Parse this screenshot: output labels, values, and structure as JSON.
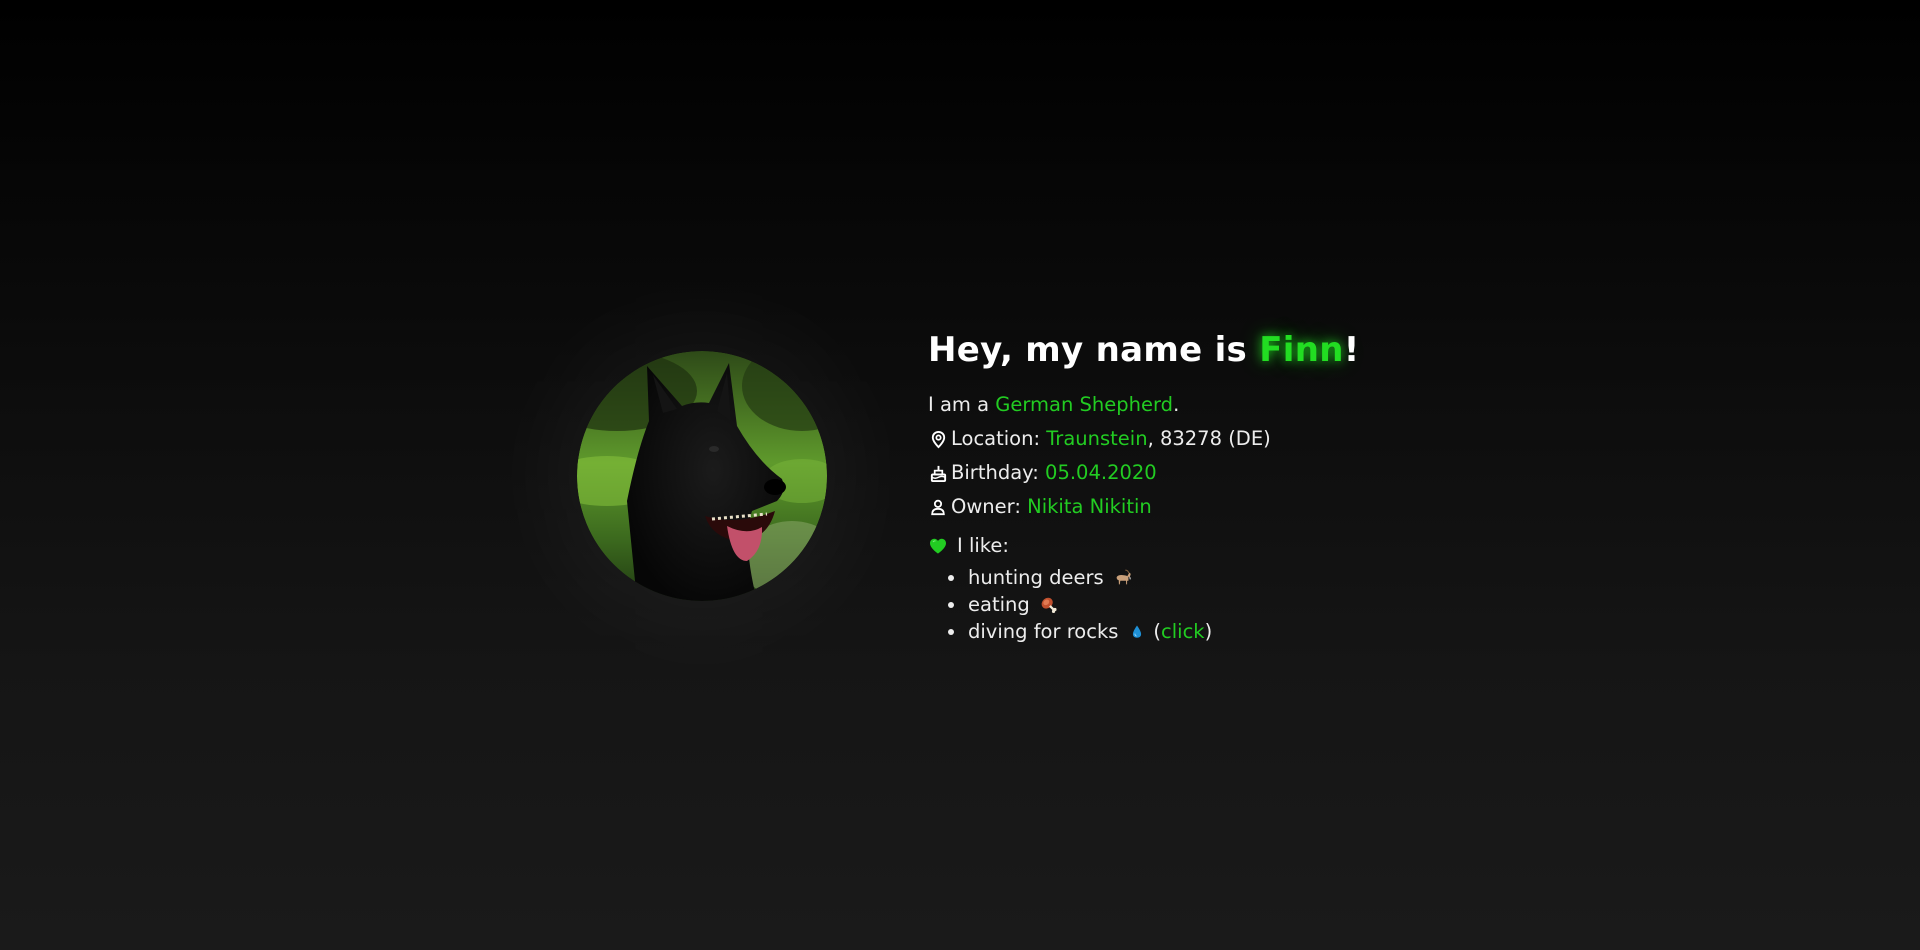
{
  "profile": {
    "photo_alt": "Finn",
    "title_prefix": "Hey, my name is ",
    "name": "Finn",
    "title_suffix": "!",
    "breed_prefix": "I am a ",
    "breed": "German Shepherd",
    "breed_suffix": ".",
    "location_label": "Location: ",
    "location_city": "Traunstein",
    "location_rest": ", 83278 (DE)",
    "birthday_label": "Birthday: ",
    "birthday": "05.04.2020",
    "owner_label": "Owner: ",
    "owner": "Nikita Nikitin",
    "likes_label": "I like:",
    "likes": [
      {
        "text": "hunting deers",
        "emoji": "goat-emoji"
      },
      {
        "text": "eating",
        "emoji": "meat-on-bone-emoji"
      },
      {
        "text": "diving for rocks",
        "emoji": "droplet-emoji",
        "paren_open": "(",
        "link": "click",
        "paren_close": ")"
      }
    ]
  },
  "icons": {
    "location": "map-pin-icon",
    "birthday": "cake-icon",
    "owner": "user-icon",
    "likes": "green-heart-icon"
  },
  "colors": {
    "accent": "#22cc22",
    "text": "#ededed",
    "background_top": "#000000",
    "background_bottom": "#1a1a1a"
  }
}
